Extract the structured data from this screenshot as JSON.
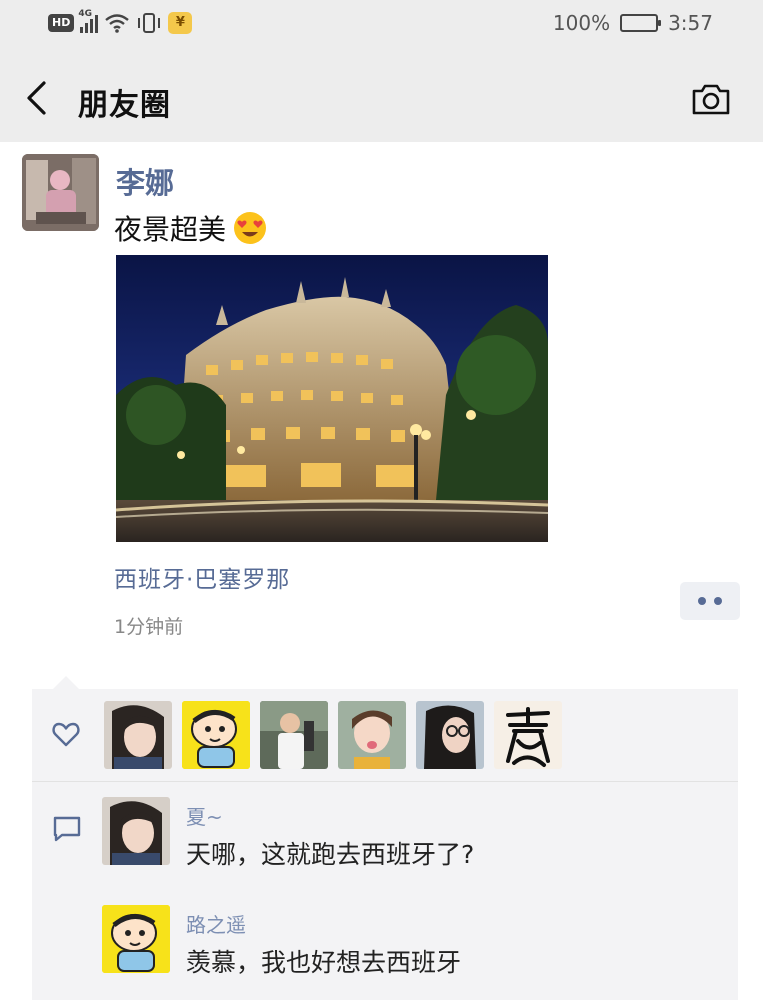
{
  "status_bar": {
    "hd": "HD",
    "network": "4G",
    "battery_text": "100%",
    "time": "3:57",
    "yen_symbol": "¥"
  },
  "nav": {
    "title": "朋友圈",
    "icons": [
      "chevron-left-icon",
      "camera-icon"
    ]
  },
  "post": {
    "username": "李娜",
    "text": "夜景超美",
    "emoji": "heart-eyes-emoji",
    "location": "西班牙·巴塞罗那",
    "time_ago": "1分钟前"
  },
  "likes": {
    "icon": "heart-icon",
    "count": 6
  },
  "comments": [
    {
      "name": "夏~",
      "text": "天哪，这就跑去西班牙了?"
    },
    {
      "name": "路之遥",
      "text": "羡慕，我也好想去西班牙"
    }
  ],
  "colors": {
    "nav_bg": "#ededed",
    "name_blue": "#576b95",
    "comment_name": "#7d8fb3",
    "interact_bg": "#f3f3f5"
  }
}
